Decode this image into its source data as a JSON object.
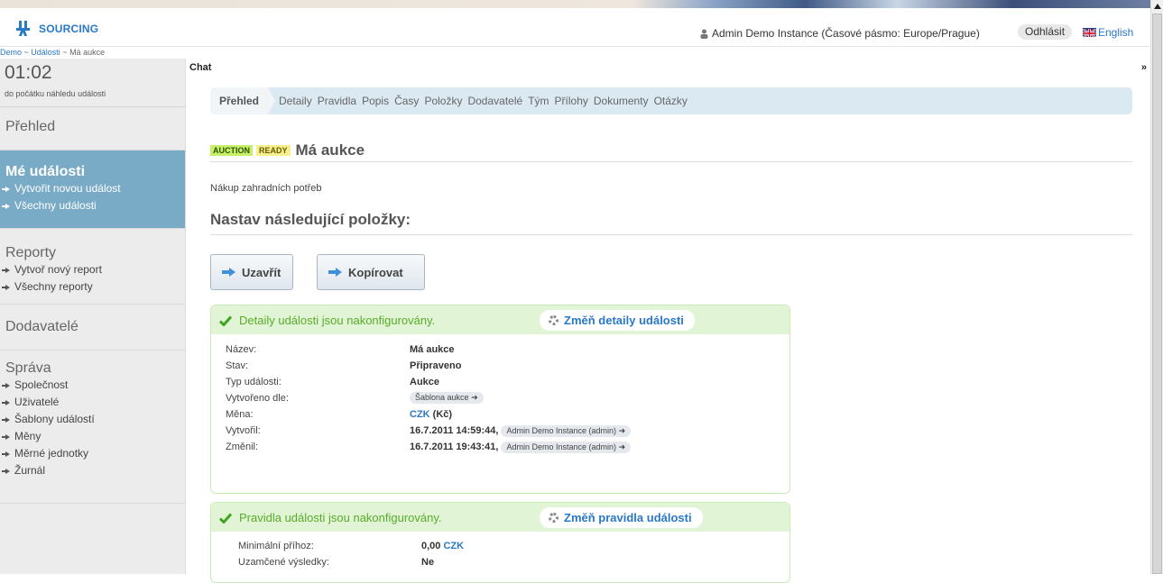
{
  "header": {
    "logo_text": "SOURCING",
    "user_info": "Admin Demo Instance (Časové pásmo: Europe/Prague)",
    "logout_label": "Odhlásit",
    "language_label": "English"
  },
  "breadcrumb": {
    "items": [
      "Demo",
      "Události",
      "Má aukce"
    ],
    "separator": " ~ "
  },
  "sidebar": {
    "timer": "01:02",
    "timer_caption": "do počátku náhledu události",
    "overview_label": "Přehled",
    "my_events": {
      "title": "Mé události",
      "links": [
        "Vytvořit novou událost",
        "Všechny události"
      ]
    },
    "reports": {
      "title": "Reporty",
      "links": [
        "Vytvoř nový report",
        "Všechny reporty"
      ]
    },
    "suppliers_label": "Dodavatelé",
    "admin": {
      "title": "Správa",
      "links": [
        "Společnost",
        "Uživatelé",
        "Šablony událostí",
        "Měny",
        "Měrné jednotky",
        "Žurnál"
      ]
    }
  },
  "chat": {
    "label": "Chat",
    "toggle": "»"
  },
  "tabs": [
    "Přehled",
    "Detaily",
    "Pravidla",
    "Popis",
    "Časy",
    "Položky",
    "Dodavatelé",
    "Tým",
    "Přílohy",
    "Dokumenty",
    "Otázky"
  ],
  "event": {
    "badge_type": "AUCTION",
    "badge_state": "READY",
    "title": "Má aukce",
    "description": "Nákup zahradních potřeb"
  },
  "section_heading": "Nastav následující položky:",
  "actions": {
    "close_label": "Uzavřít",
    "copy_label": "Kopírovat"
  },
  "details_panel": {
    "status": "Detaily události jsou nakonfigurovány.",
    "edit_label": "Změň detaily události",
    "rows": {
      "name": {
        "label": "Název:",
        "value": "Má aukce"
      },
      "state": {
        "label": "Stav:",
        "value": "Připraveno"
      },
      "type": {
        "label": "Typ události:",
        "value": "Aukce"
      },
      "created_from": {
        "label": "Vytvořeno dle:",
        "value": "Šablona aukce"
      },
      "currency": {
        "label": "Měna:",
        "code": "CZK",
        "symbol": "(Kč)"
      },
      "created": {
        "label": "Vytvořil:",
        "value": "16.7.2011 14:59:44,",
        "user": "Admin Demo Instance (admin)"
      },
      "modified": {
        "label": "Změnil:",
        "value": "16.7.2011 19:43:41,",
        "user": "Admin Demo Instance (admin)"
      }
    }
  },
  "rules_panel": {
    "status": "Pravidla události jsou nakonfigurovány.",
    "edit_label": "Změň pravidla události",
    "rows": {
      "min_bid": {
        "label": "Minimální příhoz:",
        "value": "0,00",
        "currency": "CZK"
      },
      "locked": {
        "label": "Uzamčené výsledky:",
        "value": "Ne"
      }
    }
  },
  "colors": {
    "brand_blue": "#2a78c8",
    "sidebar_active": "#79aac6",
    "panel_green": "#e1f5d6",
    "status_green": "#5aab2a"
  }
}
